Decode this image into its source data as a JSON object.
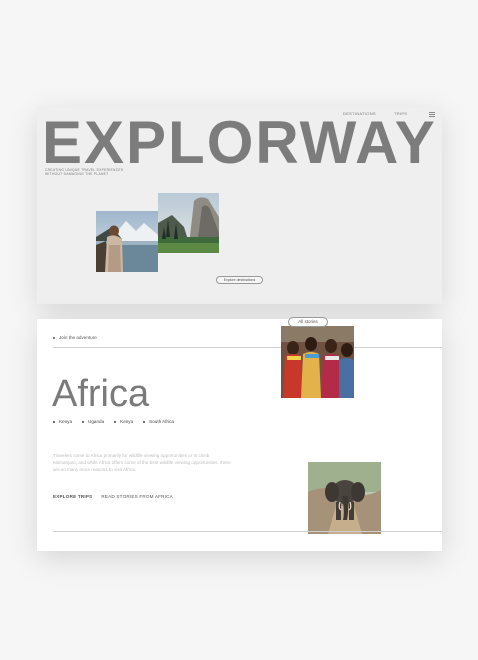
{
  "hero": {
    "nav": [
      "DESTINATIONS",
      "TRIPS"
    ],
    "brand": "EXPLORWAY",
    "tagline_line1": "CREATING UNIQUE TRAVEL EXPERIENCES",
    "tagline_line2": "WITHOUT DAMAGING THE PLANET",
    "cta": "Explore destinations"
  },
  "africa": {
    "kicker": "Join the adventure",
    "stories_label": "All stories",
    "title": "Africa",
    "countries": [
      "Kenya",
      "Uganda",
      "Kenya",
      "South Africa"
    ],
    "description": "Travelers come to Africa primarily for wildlife viewing opportunities or to climb Kilimanjaro, and while Africa offers some of the best wildlife viewing opportunities, there are so many more reasons to visit Africa.",
    "explore_label": "EXPLORE TRIPS",
    "stories_link": "READ STORIES FROM AFRICA"
  }
}
